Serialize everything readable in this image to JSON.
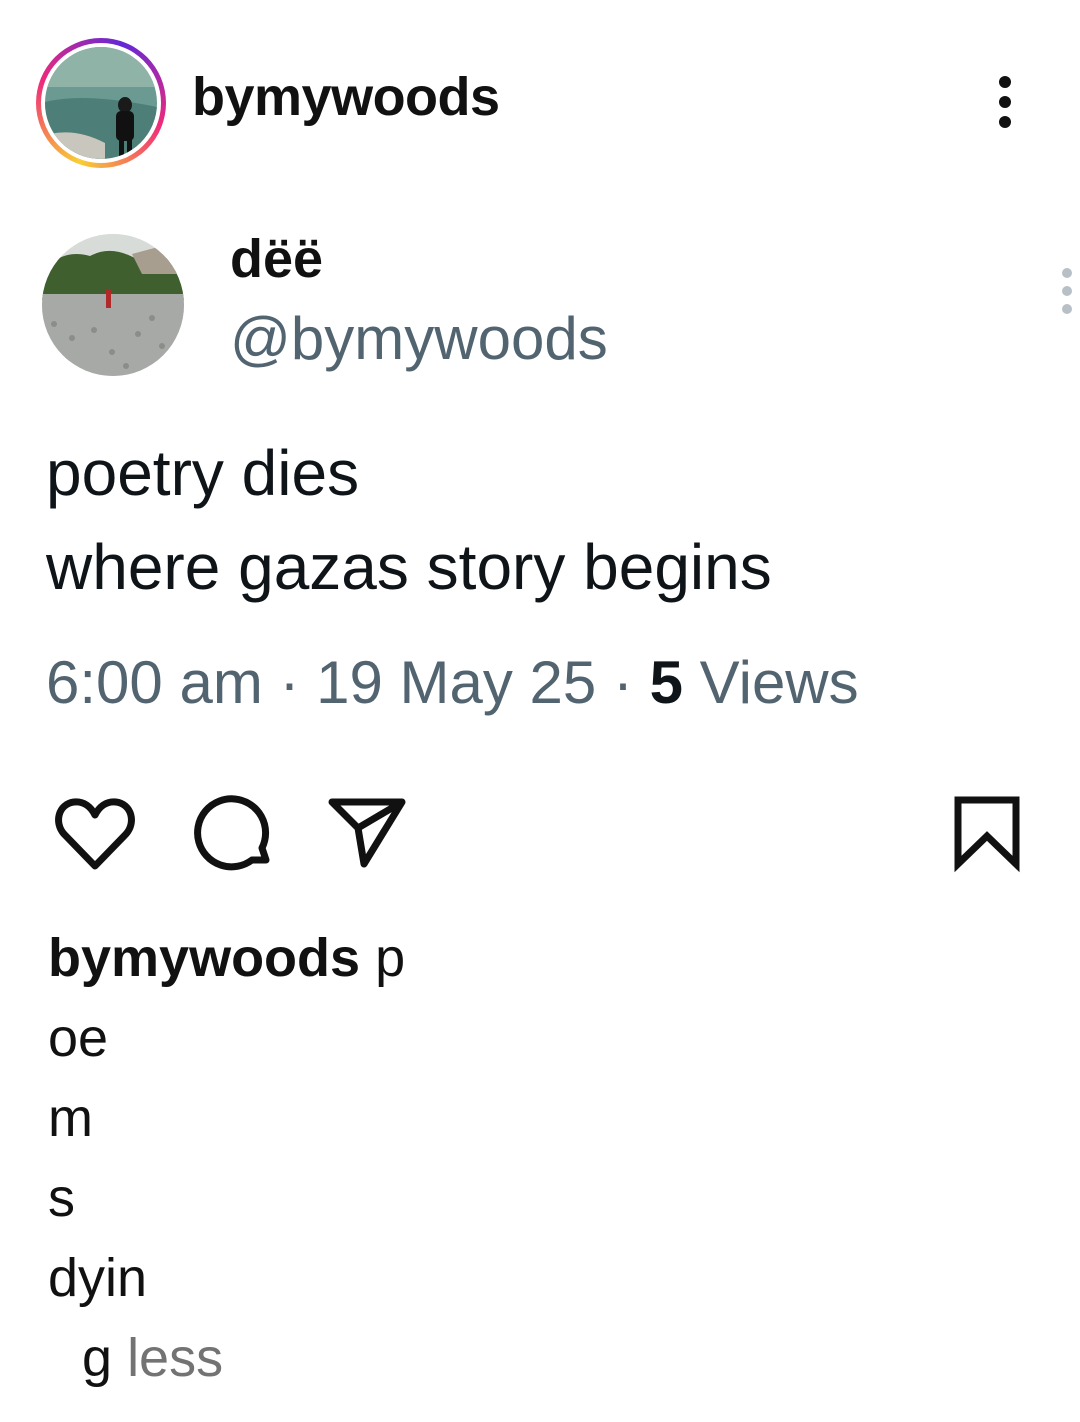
{
  "post": {
    "username": "bymywoods",
    "more_icon": "more-vertical-icon"
  },
  "tweet": {
    "display_name": "dëë",
    "handle": "@bymywoods",
    "text_line1": "poetry dies",
    "text_line2": "where gazas story begins",
    "time": "6:00 am",
    "date": "19 May 25",
    "views_count": "5",
    "views_label": "Views",
    "separator": "·"
  },
  "actions": {
    "like_icon": "heart-icon",
    "comment_icon": "comment-icon",
    "share_icon": "send-icon",
    "save_icon": "bookmark-icon"
  },
  "caption": {
    "username": "bymywoods",
    "lines": [
      "p",
      "oe",
      "m",
      "s",
      "dyin",
      "g"
    ],
    "less_label": "less"
  }
}
